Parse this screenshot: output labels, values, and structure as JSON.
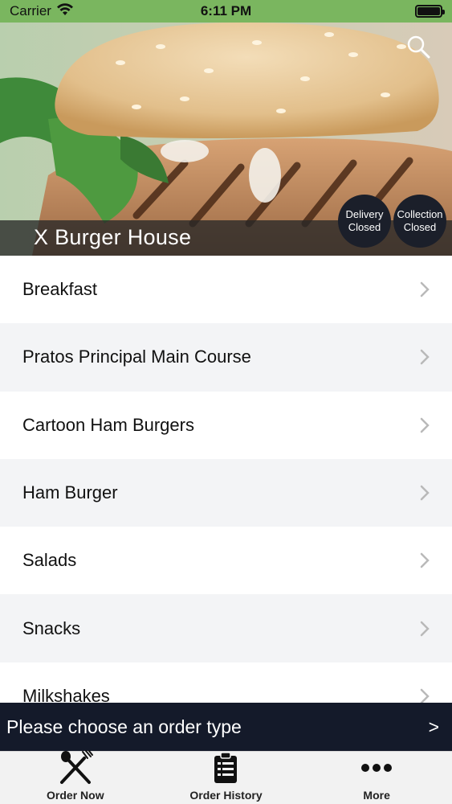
{
  "status_bar": {
    "carrier": "Carrier",
    "time": "6:11 PM"
  },
  "header": {
    "restaurant_name": "X Burger House",
    "delivery_status": {
      "line1": "Delivery",
      "line2": "Closed"
    },
    "collection_status": {
      "line1": "Collection",
      "line2": "Closed"
    },
    "search_icon": "search-icon"
  },
  "menu": {
    "categories": [
      {
        "label": "Breakfast"
      },
      {
        "label": "Pratos Principal Main Course"
      },
      {
        "label": "Cartoon Ham Burgers"
      },
      {
        "label": "Ham Burger"
      },
      {
        "label": "Salads"
      },
      {
        "label": "Snacks"
      },
      {
        "label": "Milkshakes"
      }
    ]
  },
  "order_banner": {
    "text": "Please choose an order type",
    "arrow": ">"
  },
  "tab_bar": {
    "tabs": [
      {
        "label": "Order Now",
        "icon": "fork-knife-icon"
      },
      {
        "label": "Order History",
        "icon": "clipboard-list-icon"
      },
      {
        "label": "More",
        "icon": "more-dots-icon"
      }
    ]
  },
  "colors": {
    "status_bar": "#7ab65f",
    "banner": "#141a2a",
    "circle": "#1b1f2a",
    "alt_row": "#f3f4f6"
  }
}
